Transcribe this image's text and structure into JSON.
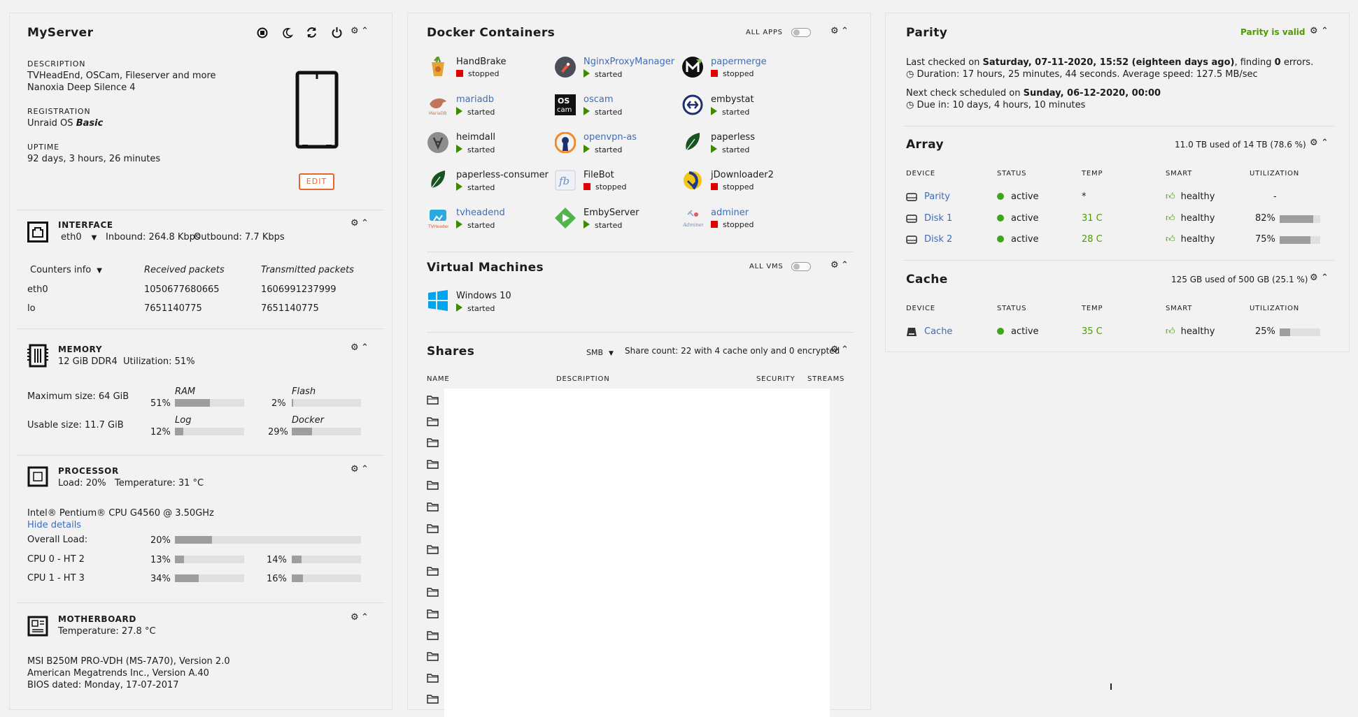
{
  "server": {
    "name": "MyServer",
    "description_label": "DESCRIPTION",
    "description_line1": "TVHeadEnd, OSCam, Fileserver and more",
    "description_line2": "Nanoxia Deep Silence 4",
    "registration_label": "REGISTRATION",
    "registration_prefix": "Unraid OS",
    "registration_type": "Basic",
    "uptime_label": "UPTIME",
    "uptime": "92 days, 3 hours, 26 minutes",
    "edit_label": "EDIT"
  },
  "interface": {
    "label": "INTERFACE",
    "selected": "eth0",
    "inbound": "Inbound: 264.8 Kbps",
    "outbound": "Outbound: 7.7 Kbps",
    "counters_label": "Counters info",
    "col_received": "Received packets",
    "col_transmitted": "Transmitted packets",
    "rows": [
      {
        "name": "eth0",
        "received": "1050677680665",
        "transmitted": "1606991237999"
      },
      {
        "name": "lo",
        "received": "7651140775",
        "transmitted": "7651140775"
      }
    ]
  },
  "memory": {
    "label": "MEMORY",
    "type": "12 GiB DDR4",
    "utilization": "Utilization: 51%",
    "max_size": "Maximum size: 64 GiB",
    "usable_size": "Usable size: 11.7 GiB",
    "ram_label": "RAM",
    "ram_pct": "51%",
    "ram_value": 51,
    "flash_label": "Flash",
    "flash_pct": "2%",
    "flash_value": 2,
    "log_label": "Log",
    "log_pct": "12%",
    "log_value": 12,
    "docker_label": "Docker",
    "docker_pct": "29%",
    "docker_value": 29
  },
  "processor": {
    "label": "PROCESSOR",
    "load": "Load: 20%",
    "temperature": "Temperature: 31 °C",
    "model": "Intel® Pentium® CPU G4560 @ 3.50GHz",
    "hide_details": "Hide details",
    "overall_label": "Overall Load:",
    "overall_pct": "20%",
    "overall_value": 20,
    "cpu0_label": "CPU 0 - HT 2",
    "cpu0_a_pct": "13%",
    "cpu0_a": 13,
    "cpu0_b_pct": "14%",
    "cpu0_b": 14,
    "cpu1_label": "CPU 1 - HT 3",
    "cpu1_a_pct": "34%",
    "cpu1_a": 34,
    "cpu1_b_pct": "16%",
    "cpu1_b": 16
  },
  "motherboard": {
    "label": "MOTHERBOARD",
    "temperature": "Temperature: 27.8 °C",
    "line1": "MSI B250M PRO-VDH (MS-7A70), Version 2.0",
    "line2": "American Megatrends Inc., Version A.40",
    "line3": "BIOS dated: Monday, 17-07-2017"
  },
  "docker": {
    "title": "Docker Containers",
    "all_apps": "ALL APPS",
    "containers": [
      {
        "name": "HandBrake",
        "status": "stopped",
        "link": false,
        "icon": "handbrake-icon"
      },
      {
        "name": "NginxProxyManager",
        "status": "started",
        "link": true,
        "icon": "nginx-proxy-manager-icon"
      },
      {
        "name": "papermerge",
        "status": "stopped",
        "link": true,
        "icon": "papermerge-icon"
      },
      {
        "name": "mariadb",
        "status": "started",
        "link": true,
        "icon": "mariadb-icon"
      },
      {
        "name": "oscam",
        "status": "started",
        "link": true,
        "icon": "oscam-icon"
      },
      {
        "name": "embystat",
        "status": "started",
        "link": false,
        "icon": "embystat-icon"
      },
      {
        "name": "heimdall",
        "status": "started",
        "link": false,
        "icon": "heimdall-icon"
      },
      {
        "name": "openvpn-as",
        "status": "started",
        "link": true,
        "icon": "openvpn-icon"
      },
      {
        "name": "paperless",
        "status": "started",
        "link": false,
        "icon": "paperless-icon"
      },
      {
        "name": "paperless-consumer",
        "status": "started",
        "link": false,
        "icon": "paperless-consumer-icon"
      },
      {
        "name": "FileBot",
        "status": "stopped",
        "link": false,
        "icon": "filebot-icon"
      },
      {
        "name": "jDownloader2",
        "status": "stopped",
        "link": false,
        "icon": "jdownloader-icon"
      },
      {
        "name": "tvheadend",
        "status": "started",
        "link": true,
        "icon": "tvheadend-icon"
      },
      {
        "name": "EmbyServer",
        "status": "started",
        "link": false,
        "icon": "emby-icon"
      },
      {
        "name": "adminer",
        "status": "stopped",
        "link": true,
        "icon": "adminer-icon"
      }
    ]
  },
  "vms": {
    "title": "Virtual Machines",
    "all_vms": "ALL VMS",
    "name": "Windows 10",
    "status": "started"
  },
  "shares": {
    "title": "Shares",
    "protocol": "SMB",
    "count": "Share count: 22 with 4 cache only and 0 encrypted",
    "col_name": "NAME",
    "col_description": "DESCRIPTION",
    "col_security": "SECURITY",
    "col_streams": "STREAMS",
    "rows_visible": 15
  },
  "parity": {
    "title": "Parity",
    "status": "Parity is valid",
    "last_prefix": "Last checked on ",
    "last_date": "Saturday, 07-11-2020, 15:52 (eighteen days ago)",
    "last_mid": ", finding ",
    "last_errors": "0",
    "last_suffix": " errors.",
    "duration": "Duration: 17 hours, 25 minutes, 44 seconds. Average speed: 127.5 MB/sec",
    "next_prefix": "Next check scheduled on ",
    "next_date": "Sunday, 06-12-2020, 00:00",
    "due": "Due in: 10 days, 4 hours, 10 minutes"
  },
  "array": {
    "title": "Array",
    "usage": "11.0 TB used of 14 TB (78.6 %)",
    "cols": [
      "DEVICE",
      "STATUS",
      "TEMP",
      "SMART",
      "UTILIZATION"
    ],
    "rows": [
      {
        "device": "Parity",
        "status": "active",
        "temp": "*",
        "smart": "healthy",
        "util": "-",
        "util_value": null
      },
      {
        "device": "Disk 1",
        "status": "active",
        "temp": "31 C",
        "smart": "healthy",
        "util": "82%",
        "util_value": 82
      },
      {
        "device": "Disk 2",
        "status": "active",
        "temp": "28 C",
        "smart": "healthy",
        "util": "75%",
        "util_value": 75
      }
    ]
  },
  "cache": {
    "title": "Cache",
    "usage": "125 GB used of 500 GB (25.1 %)",
    "cols": [
      "DEVICE",
      "STATUS",
      "TEMP",
      "SMART",
      "UTILIZATION"
    ],
    "row": {
      "device": "Cache",
      "status": "active",
      "temp": "35 C",
      "smart": "healthy",
      "util": "25%",
      "util_value": 25
    }
  }
}
